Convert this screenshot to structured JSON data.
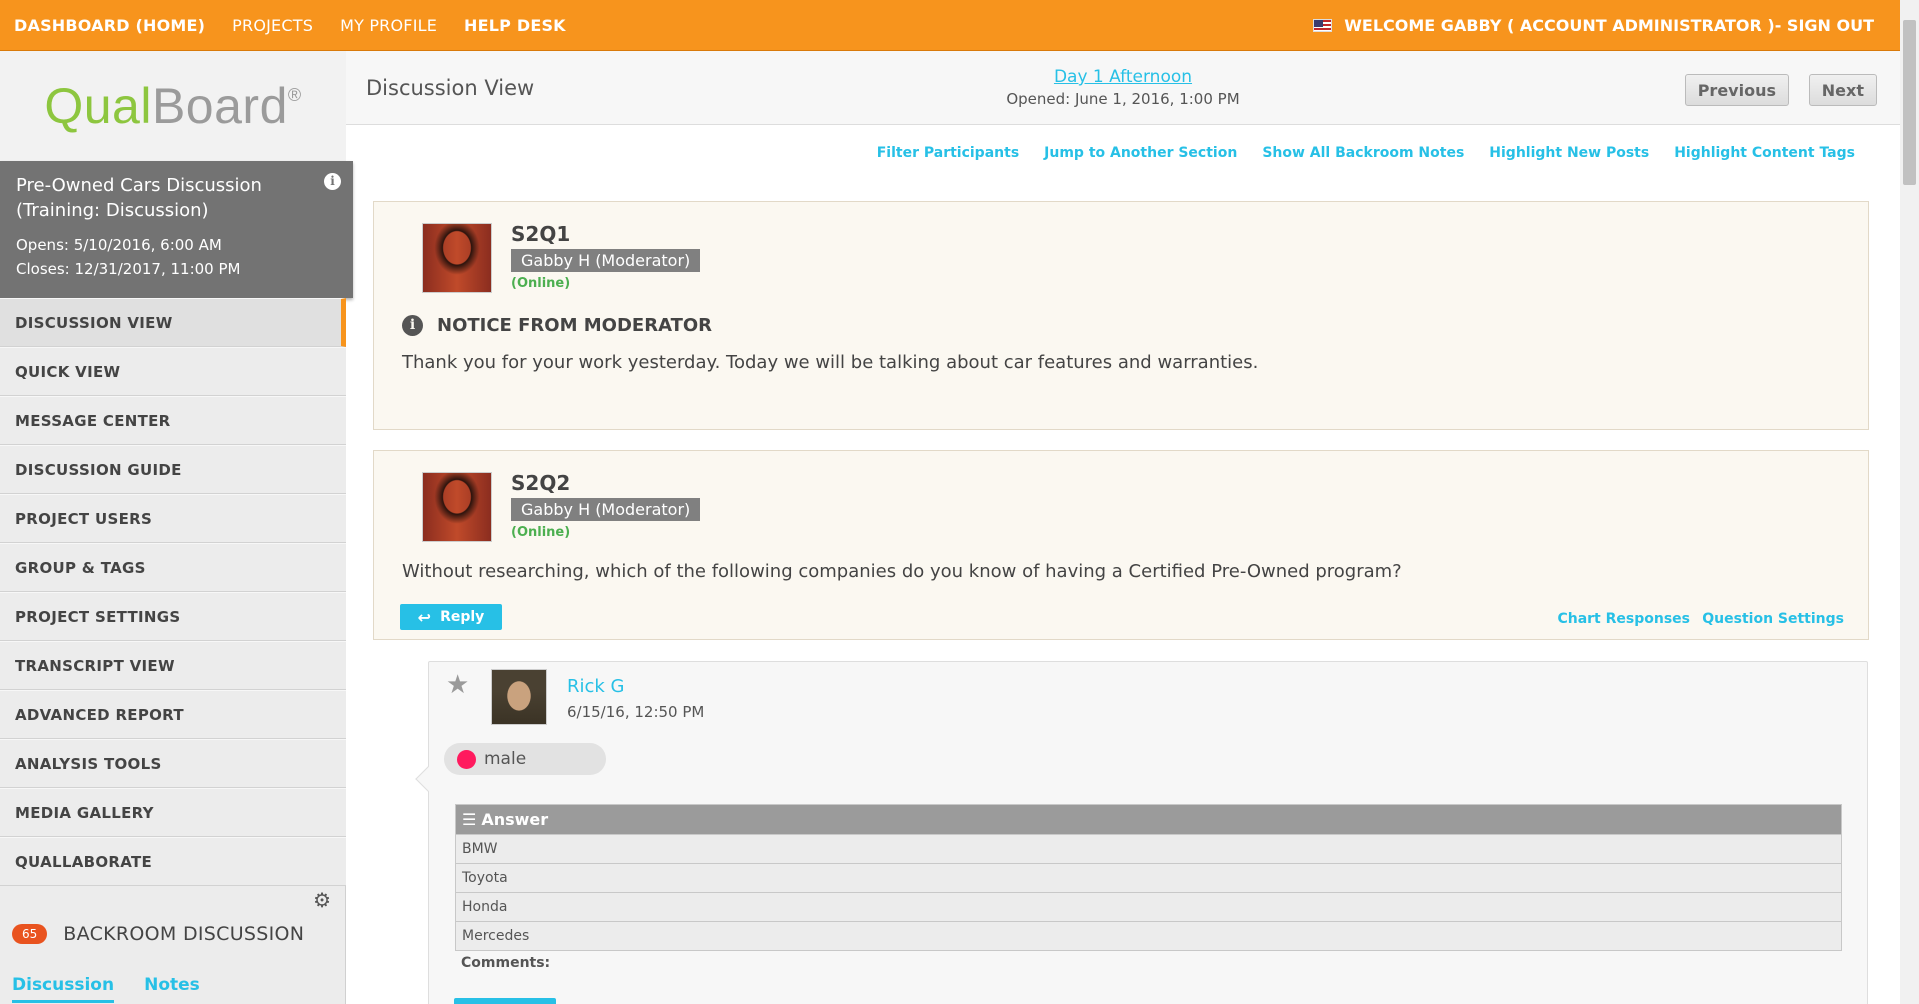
{
  "topbar": {
    "nav": [
      "DASHBOARD (HOME)",
      "PROJECTS",
      "MY PROFILE",
      "HELP DESK"
    ],
    "welcome": "WELCOME GABBY ( ACCOUNT ADMINISTRATOR )- SIGN OUT"
  },
  "logo": {
    "qual": "Qual",
    "board": "Board",
    "reg": "®"
  },
  "project": {
    "title": "Pre-Owned Cars Discussion",
    "subtitle": "(Training: Discussion)",
    "opens": "Opens: 5/10/2016, 6:00 AM",
    "closes": "Closes: 12/31/2017, 11:00 PM",
    "info_icon": "i"
  },
  "menu": [
    "DISCUSSION VIEW",
    "QUICK VIEW",
    "MESSAGE CENTER",
    "DISCUSSION GUIDE",
    "PROJECT USERS",
    "GROUP & TAGS",
    "PROJECT SETTINGS",
    "TRANSCRIPT VIEW",
    "ADVANCED REPORT",
    "ANALYSIS TOOLS",
    "MEDIA GALLERY",
    "QUALLABORATE"
  ],
  "backroom": {
    "count": "65",
    "label": "BACKROOM DISCUSSION",
    "tabs": [
      "Discussion",
      "Notes"
    ]
  },
  "main": {
    "title": "Discussion View",
    "section_link": "Day 1 Afternoon",
    "opened": "Opened: June 1, 2016, 1:00 PM",
    "prev": "Previous",
    "next": "Next",
    "toolbar": [
      "Filter Participants",
      "Jump to Another Section",
      "Show All Backroom Notes",
      "Highlight New Posts",
      "Highlight Content Tags"
    ]
  },
  "q1": {
    "id": "S2Q1",
    "author": "Gabby H (Moderator)",
    "status": "(Online)",
    "notice_title": "NOTICE FROM MODERATOR",
    "body": "Thank you for your work yesterday. Today we will be talking about car features and warranties."
  },
  "q2": {
    "id": "S2Q2",
    "author": "Gabby H (Moderator)",
    "status": "(Online)",
    "body": "Without researching, which of the following companies do you know of having a Certified Pre-Owned program?",
    "reply": "Reply",
    "chart": "Chart Responses",
    "settings": "Question Settings"
  },
  "response": {
    "star": "★",
    "name": "Rick G",
    "time": "6/15/16, 12:50 PM",
    "tag": "male",
    "tag_color": "#ff1a5e",
    "answer_header": "Answer",
    "answers": [
      "BMW",
      "Toyota",
      "Honda",
      "Mercedes"
    ],
    "comments": "Comments:"
  },
  "colors": {
    "accent": "#f7941d",
    "link": "#27c0e6"
  }
}
